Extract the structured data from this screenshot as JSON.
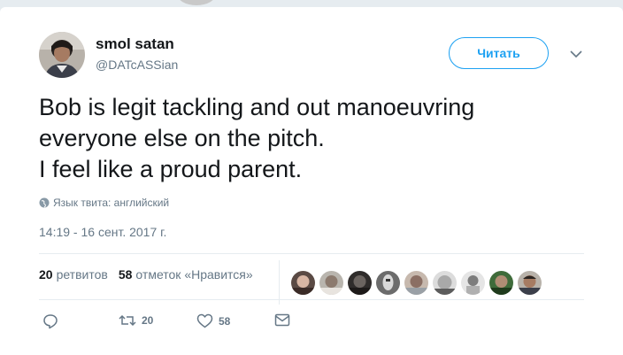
{
  "tweet": {
    "author": {
      "display_name": "smol satan",
      "handle": "@DATcASSian"
    },
    "follow_label": "Читать",
    "text_lines": [
      "Bob is legit tackling and out manoeuvring",
      "everyone else on the pitch.",
      "I feel like a proud parent."
    ],
    "language_label": "Язык твита: английский",
    "timestamp": "14:19 - 16 сент. 2017 г.",
    "stats": {
      "retweets_count": "20",
      "retweets_label": "ретвитов",
      "likes_count": "58",
      "likes_label": "отметок «Нравится»"
    },
    "actions": {
      "reply": "",
      "retweet_count": "20",
      "like_count": "58"
    }
  },
  "colors": {
    "accent": "#1da1f2",
    "secondary_text": "#657786",
    "background": "#e6ecf0"
  },
  "icons": [
    "globe-icon",
    "chevron-down-icon",
    "reply-icon",
    "retweet-icon",
    "heart-icon",
    "message-icon"
  ]
}
